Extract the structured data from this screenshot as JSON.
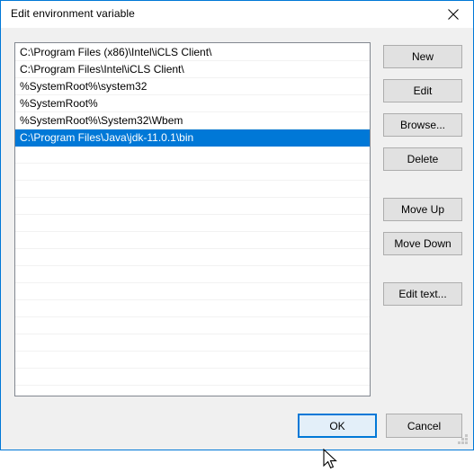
{
  "window": {
    "title": "Edit environment variable",
    "close_icon": "close-icon",
    "border_color": "#0078d7",
    "background_color": "#f0f0f0"
  },
  "list": {
    "selected_index": 5,
    "selection_color": "#0078d7",
    "selection_text_color": "#ffffff",
    "empty_row_count": 14,
    "items": [
      "C:\\Program Files (x86)\\Intel\\iCLS Client\\",
      "C:\\Program Files\\Intel\\iCLS Client\\",
      "%SystemRoot%\\system32",
      "%SystemRoot%",
      "%SystemRoot%\\System32\\Wbem",
      "C:\\Program Files\\Java\\jdk-11.0.1\\bin"
    ]
  },
  "side_buttons": {
    "new": "New",
    "edit": "Edit",
    "browse": "Browse...",
    "delete": "Delete",
    "move_up": "Move Up",
    "move_down": "Move Down",
    "edit_text": "Edit text..."
  },
  "bottom_buttons": {
    "ok": "OK",
    "cancel": "Cancel",
    "ok_focus_color": "#0078d7",
    "ok_fill_color": "#e3eff9"
  },
  "resize_grip": {
    "name": "resize-grip"
  },
  "cursor": {
    "name": "mouse-cursor-arrow"
  }
}
